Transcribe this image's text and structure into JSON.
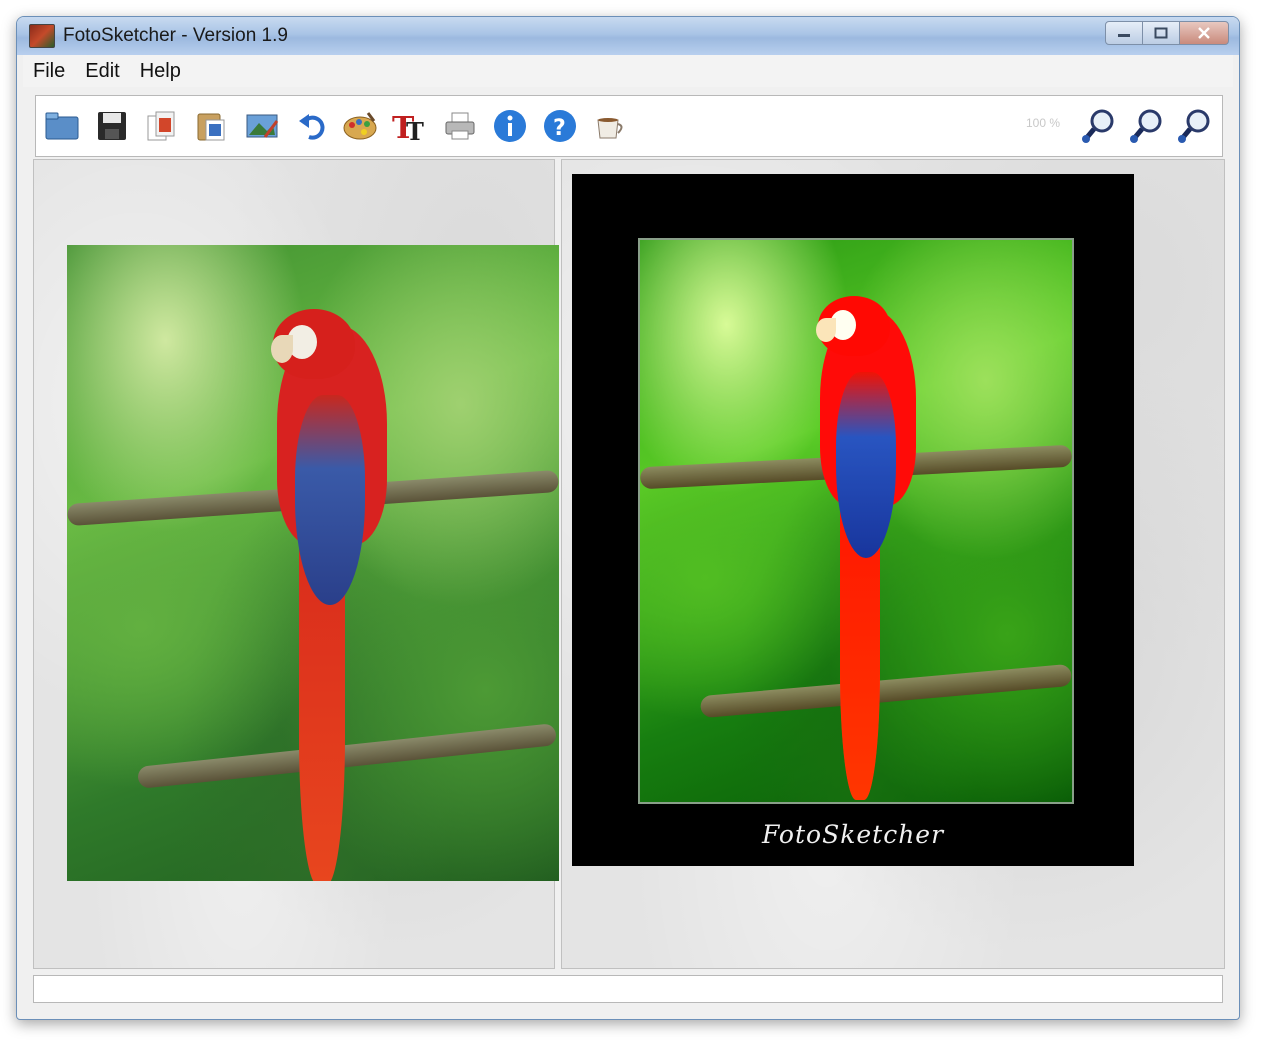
{
  "window": {
    "title": "FotoSketcher - Version 1.9",
    "controls": [
      "minimize",
      "maximize",
      "close"
    ]
  },
  "menubar": {
    "items": [
      {
        "label": "File"
      },
      {
        "label": "Edit"
      },
      {
        "label": "Help"
      }
    ]
  },
  "toolbar": {
    "icons": [
      "folder-open-icon",
      "save-icon",
      "copy-icon",
      "paste-icon",
      "image-icon",
      "undo-icon",
      "palette-icon",
      "text-icon",
      "print-icon",
      "info-icon",
      "help-icon",
      "coffee-cup-icon"
    ],
    "zoom_level": "100 %",
    "zoom_icons": [
      "zoom-in-icon",
      "zoom-out-icon",
      "zoom-fit-icon"
    ]
  },
  "preview": {
    "caption": "FotoSketcher"
  },
  "colors": {
    "title_gradient_top": "#c8daf0",
    "toolbar_bg": "#ffffff",
    "panel_bg": "#e4e4e4",
    "frame": "#000000"
  }
}
